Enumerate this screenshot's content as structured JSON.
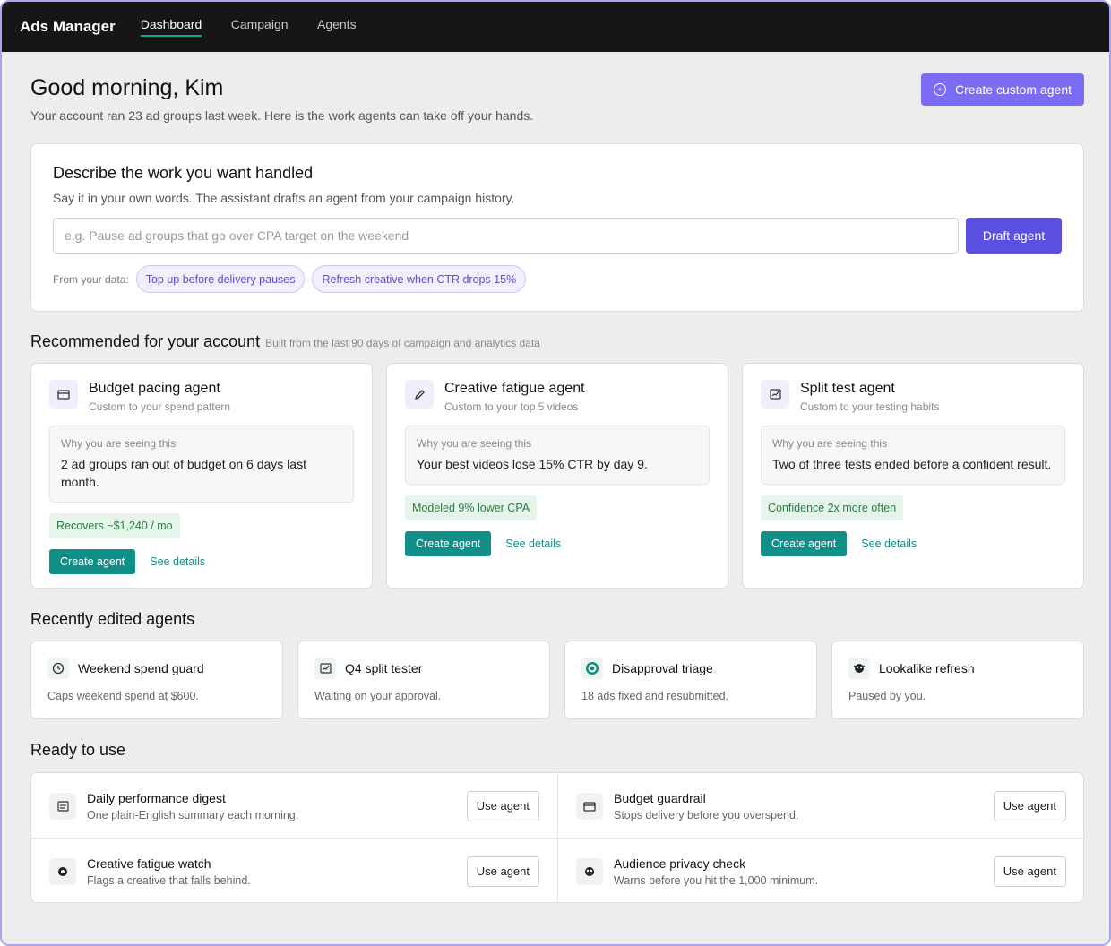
{
  "app": {
    "title": "Ads Manager",
    "nav": [
      {
        "label": "Dashboard",
        "active": true
      },
      {
        "label": "Campaign",
        "active": false
      },
      {
        "label": "Agents",
        "active": false
      }
    ]
  },
  "header": {
    "greeting": "Good morning, Kim",
    "subtitle": "Your account ran 23 ad groups last week. Here is the work agents can take off your hands.",
    "create_button": "Create custom agent"
  },
  "describe": {
    "title": "Describe the work you want handled",
    "subtitle": "Say it in your own words. The assistant drafts an agent from your campaign history.",
    "placeholder": "e.g. Pause ad groups that go over CPA target on the weekend",
    "draft_button": "Draft agent",
    "from_label": "From your data:",
    "chips": [
      "Top up before delivery pauses",
      "Refresh creative when CTR drops 15%"
    ]
  },
  "recommended": {
    "title": "Recommended for your account",
    "hint": "Built from the last 90 days of campaign and analytics data",
    "why_label": "Why you are seeing this",
    "create_label": "Create agent",
    "details_label": "See details",
    "cards": [
      {
        "icon": "wallet-icon",
        "title": "Budget pacing agent",
        "subtitle": "Custom to your spend pattern",
        "why": "2 ad groups ran out of budget on 6 days last month.",
        "badge": "Recovers ~$1,240 / mo"
      },
      {
        "icon": "pencil-icon",
        "title": "Creative fatigue agent",
        "subtitle": "Custom to your top 5 videos",
        "why": "Your best videos lose 15% CTR by day 9.",
        "badge": "Modeled 9% lower CPA"
      },
      {
        "icon": "chart-icon",
        "title": "Split test agent",
        "subtitle": "Custom to your testing habits",
        "why": "Two of three tests ended before a confident result.",
        "badge": "Confidence 2x more often"
      }
    ]
  },
  "recent": {
    "title": "Recently edited agents",
    "items": [
      {
        "icon": "clock-icon",
        "title": "Weekend spend guard",
        "desc": "Caps weekend spend at $600."
      },
      {
        "icon": "chart-icon",
        "title": "Q4 split tester",
        "desc": "Waiting on your approval."
      },
      {
        "icon": "target-icon",
        "title": "Disapproval triage",
        "desc": "18 ads fixed and resubmitted."
      },
      {
        "icon": "bug-icon",
        "title": "Lookalike refresh",
        "desc": "Paused by you."
      }
    ]
  },
  "ready": {
    "title": "Ready to use",
    "use_label": "Use agent",
    "items": [
      {
        "icon": "calendar-icon",
        "title": "Daily performance digest",
        "desc": "One plain-English summary each morning."
      },
      {
        "icon": "wallet-icon",
        "title": "Budget guardrail",
        "desc": "Stops delivery before you overspend."
      },
      {
        "icon": "eye-icon",
        "title": "Creative fatigue watch",
        "desc": "Flags a creative that falls behind."
      },
      {
        "icon": "shield-icon",
        "title": "Audience privacy check",
        "desc": "Warns before you hit the 1,000 minimum."
      }
    ]
  }
}
